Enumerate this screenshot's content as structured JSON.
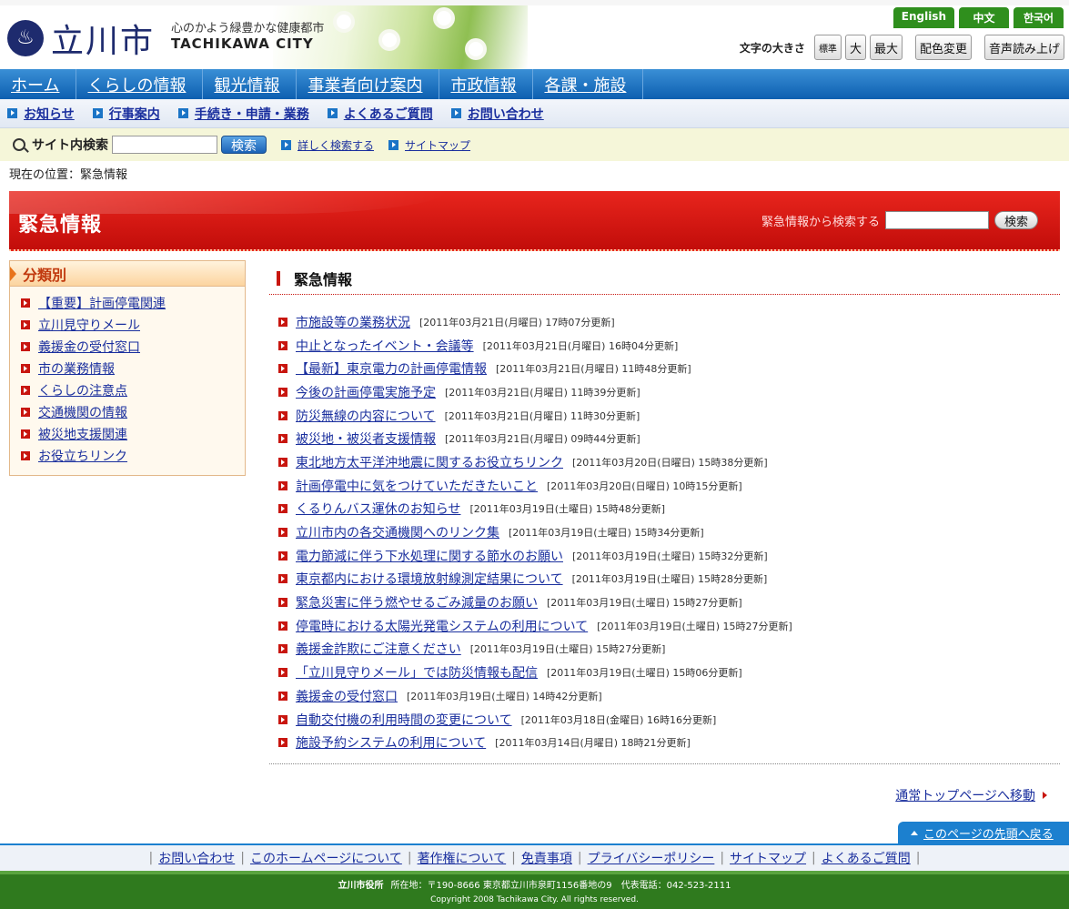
{
  "header": {
    "logo_mark": "♨",
    "city_name": "立川市",
    "slogan": "心のかよう緑豊かな健康都市",
    "city_name_en": "TACHIKAWA CITY",
    "languages": [
      "English",
      "中文",
      "한국어"
    ],
    "text_size_label": "文字の大きさ",
    "text_size_options": [
      "標準",
      "大",
      "最大"
    ],
    "color_change": "配色変更",
    "voice_read": "音声読み上げ"
  },
  "global_nav": [
    "ホーム",
    "くらしの情報",
    "観光情報",
    "事業者向け案内",
    "市政情報",
    "各課・施設"
  ],
  "sub_nav": [
    "お知らせ",
    "行事案内",
    "手続き・申請・業務",
    "よくあるご質問",
    "お問い合わせ"
  ],
  "site_search": {
    "label": "サイト内検索",
    "button": "検索",
    "detailed_link": "詳しく検索する",
    "sitemap_link": "サイトマップ"
  },
  "breadcrumb": "現在の位置：緊急情報",
  "banner": {
    "title": "緊急情報",
    "search_label": "緊急情報から検索する",
    "search_button": "検索"
  },
  "sidebar": {
    "title": "分類別",
    "items": [
      "【重要】計画停電関連",
      "立川見守りメール",
      "義援金の受付窓口",
      "市の業務情報",
      "くらしの注意点",
      "交通機関の情報",
      "被災地支援関連",
      "お役立ちリンク"
    ]
  },
  "main": {
    "title": "緊急情報",
    "items": [
      {
        "title": "市施設等の業務状況",
        "date": "[2011年03月21日(月曜日) 17時07分更新]"
      },
      {
        "title": "中止となったイベント・会議等",
        "date": "[2011年03月21日(月曜日) 16時04分更新]"
      },
      {
        "title": "【最新】東京電力の計画停電情報",
        "date": "[2011年03月21日(月曜日) 11時48分更新]"
      },
      {
        "title": "今後の計画停電実施予定",
        "date": "[2011年03月21日(月曜日) 11時39分更新]"
      },
      {
        "title": "防災無線の内容について",
        "date": "[2011年03月21日(月曜日) 11時30分更新]"
      },
      {
        "title": "被災地・被災者支援情報",
        "date": "[2011年03月21日(月曜日) 09時44分更新]"
      },
      {
        "title": "東北地方太平洋沖地震に関するお役立ちリンク",
        "date": "[2011年03月20日(日曜日) 15時38分更新]"
      },
      {
        "title": "計画停電中に気をつけていただきたいこと",
        "date": "[2011年03月20日(日曜日) 10時15分更新]"
      },
      {
        "title": "くるりんバス運休のお知らせ",
        "date": "[2011年03月19日(土曜日) 15時48分更新]"
      },
      {
        "title": "立川市内の各交通機関へのリンク集",
        "date": "[2011年03月19日(土曜日) 15時34分更新]"
      },
      {
        "title": "電力節減に伴う下水処理に関する節水のお願い",
        "date": "[2011年03月19日(土曜日) 15時32分更新]"
      },
      {
        "title": "東京都内における環境放射線測定結果について",
        "date": "[2011年03月19日(土曜日) 15時28分更新]"
      },
      {
        "title": "緊急災害に伴う燃やせるごみ減量のお願い",
        "date": "[2011年03月19日(土曜日) 15時27分更新]"
      },
      {
        "title": "停電時における太陽光発電システムの利用について",
        "date": "[2011年03月19日(土曜日) 15時27分更新]"
      },
      {
        "title": "義援金詐欺にご注意ください",
        "date": "[2011年03月19日(土曜日) 15時27分更新]"
      },
      {
        "title": "「立川見守りメール」では防災情報も配信",
        "date": "[2011年03月19日(土曜日) 15時06分更新]"
      },
      {
        "title": "義援金の受付窓口",
        "date": "[2011年03月19日(土曜日) 14時42分更新]"
      },
      {
        "title": "自動交付機の利用時間の変更について",
        "date": "[2011年03月18日(金曜日) 16時16分更新]"
      },
      {
        "title": "施設予約システムの利用について",
        "date": "[2011年03月14日(月曜日) 18時21分更新]"
      }
    ]
  },
  "normal_top_link": "通常トップページへ移動",
  "page_top": "このページの先頭へ戻る",
  "footer_nav": [
    "お問い合わせ",
    "このホームページについて",
    "著作権について",
    "免責事項",
    "プライバシーポリシー",
    "サイトマップ",
    "よくあるご質問"
  ],
  "footer": {
    "office": "立川市役所",
    "address": "所在地：〒190-8666 東京都立川市泉町1156番地の9　代表電話：042-523-2111",
    "copyright": "Copyright 2008 Tachikawa City. All rights reserved."
  },
  "colors": {
    "nav_blue": "#0d5fb0",
    "emergency_red": "#c8160f",
    "footer_green": "#2f7a1e",
    "link": "#1a2f9e"
  }
}
